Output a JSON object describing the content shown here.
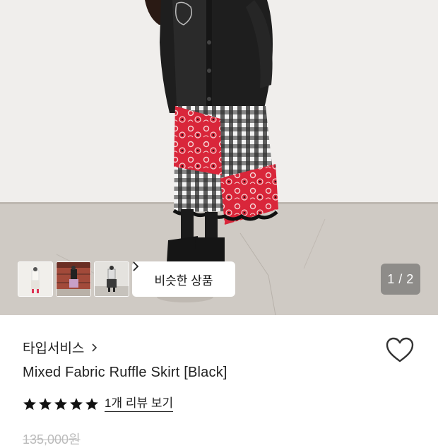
{
  "gallery": {
    "main_image": "skirt-model-photo",
    "counter": "1 / 2",
    "similar_button_label": "비슷한 상품",
    "thumbnails": [
      "thumbnail-1",
      "thumbnail-2",
      "thumbnail-3"
    ]
  },
  "product": {
    "brand": "타입서비스",
    "title": "Mixed Fabric Ruffle Skirt [Black]",
    "rating_stars": 5,
    "review_link": "1개 리뷰 보기",
    "price": "135,000원"
  },
  "colors": {
    "star": "#111111",
    "heart_outline": "#333333",
    "counter_bg": "#5a5a5a"
  }
}
